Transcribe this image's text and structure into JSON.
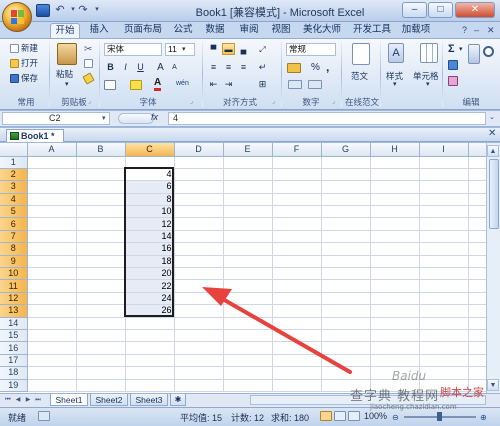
{
  "window": {
    "title": "Book1  [兼容模式] - Microsoft Excel",
    "controls": [
      "–",
      "□",
      "✕"
    ]
  },
  "ribbon_tabs": [
    "开始",
    "插入",
    "页面布局",
    "公式",
    "数据",
    "审阅",
    "视图",
    "美化大师",
    "开发工具",
    "加载项"
  ],
  "clipboard": {
    "new": "新建",
    "open": "打开",
    "save": "保存",
    "paste": "粘贴",
    "group_common": "常用",
    "group_clipboard": "剪贴板"
  },
  "font": {
    "name": "宋体",
    "size": "11",
    "bold": "B",
    "italic": "I",
    "underline": "U",
    "grow": "A",
    "shrink": "A",
    "color_letter": "A",
    "wen": "wén",
    "group": "字体"
  },
  "alignment": {
    "group": "对齐方式"
  },
  "number": {
    "format": "常规",
    "percent": "%",
    "comma": ",",
    "group": "数字"
  },
  "model": {
    "label": "范文",
    "group": "在线范文"
  },
  "styles": {
    "label": "样式"
  },
  "cells": {
    "label": "单元格"
  },
  "editing": {
    "sigma": "Σ",
    "group": "编辑"
  },
  "formula_bar": {
    "name_box": "C2",
    "fx": "fx",
    "content": "4"
  },
  "workbook": {
    "tab": "Book1 *"
  },
  "columns": [
    "A",
    "B",
    "C",
    "D",
    "E",
    "F",
    "G",
    "H",
    "I"
  ],
  "rows": [
    "1",
    "2",
    "3",
    "4",
    "5",
    "6",
    "7",
    "8",
    "9",
    "10",
    "11",
    "12",
    "13",
    "14",
    "15",
    "16",
    "17",
    "18",
    "19"
  ],
  "selected_column": "C",
  "selected_rows": [
    "2",
    "3",
    "4",
    "5",
    "6",
    "7",
    "8",
    "9",
    "10",
    "11",
    "12",
    "13"
  ],
  "column_c_values": [
    "4",
    "6",
    "8",
    "10",
    "12",
    "14",
    "16",
    "18",
    "20",
    "22",
    "24",
    "26"
  ],
  "sheets": [
    "Sheet1",
    "Sheet2",
    "Sheet3"
  ],
  "status": {
    "mode": "就绪",
    "average": "平均值: 15",
    "count": "计数: 12",
    "sum": "求和: 180",
    "zoom": "100%"
  },
  "watermark": {
    "line1": "查字典 教程网",
    "line2": "jiaocheng.chazidian.com",
    "baidu": "Baidu",
    "site": "脚本之家"
  },
  "colors": {
    "accent_arrow": "#e8423f",
    "selection_header": "#f6b44c",
    "ribbon_bg": "#dfe9f6"
  }
}
